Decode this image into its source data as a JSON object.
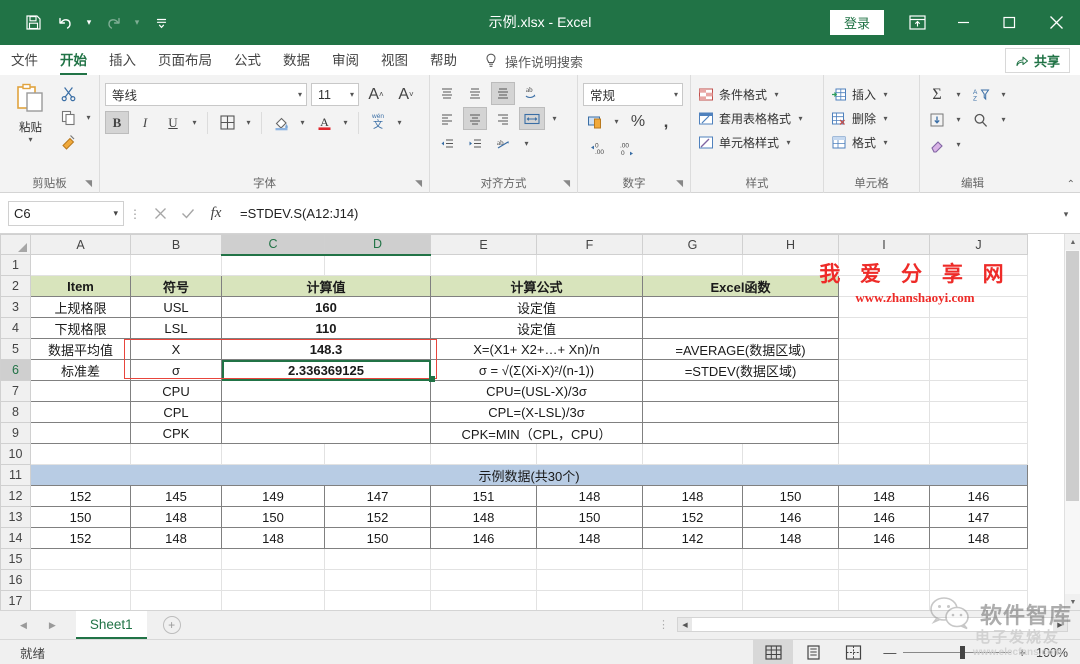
{
  "titlebar": {
    "document_title": "示例.xlsx  -  Excel",
    "quick_access": [
      {
        "name": "save",
        "glyph": "save-icon"
      },
      {
        "name": "undo",
        "glyph": "undo-icon"
      },
      {
        "name": "redo",
        "glyph": "redo-icon"
      },
      {
        "name": "customize",
        "glyph": "more-icon"
      }
    ],
    "signin_label": "登录",
    "ribbon_display_label": "ribbon-display-options",
    "minimize_label": "—",
    "maximize_label": "▢",
    "close_label": "✕"
  },
  "ribbon_tabs": [
    {
      "label": "文件",
      "active": false
    },
    {
      "label": "开始",
      "active": true
    },
    {
      "label": "插入",
      "active": false
    },
    {
      "label": "页面布局",
      "active": false
    },
    {
      "label": "公式",
      "active": false
    },
    {
      "label": "数据",
      "active": false
    },
    {
      "label": "审阅",
      "active": false
    },
    {
      "label": "视图",
      "active": false
    },
    {
      "label": "帮助",
      "active": false
    }
  ],
  "tell_me": "操作说明搜索",
  "share_label": "共享",
  "ribbon": {
    "clipboard": {
      "label": "剪贴板",
      "paste_label": "粘贴",
      "cut_label": "剪切",
      "copy_label": "复制",
      "format_painter_label": "格式刷"
    },
    "font": {
      "label": "字体",
      "font_name": "等线",
      "font_size": "11",
      "grow_label": "A",
      "shrink_label": "A",
      "bold_label": "B",
      "italic_label": "I",
      "underline_label": "U",
      "border_label": "borders-icon",
      "fill_label": "fill-color-icon",
      "fontcolor_label": "font-color-icon",
      "phonetic_label": "拼音"
    },
    "alignment": {
      "label": "对齐方式",
      "wrap_label": "自动换行",
      "merge_label": "合并后居中"
    },
    "number": {
      "label": "数字",
      "format_value": "常规",
      "percent_label": "%",
      "comma_label": "，"
    },
    "styles": {
      "label": "样式",
      "items": [
        "条件格式",
        "套用表格格式",
        "单元格样式"
      ]
    },
    "cells": {
      "label": "单元格",
      "items": [
        "插入",
        "删除",
        "格式"
      ]
    },
    "editing": {
      "label": "编辑",
      "sum_label": "Σ",
      "sort_label": "排序和筛选",
      "fill_label": "填充",
      "find_label": "查找和选择",
      "clear_label": "清除"
    }
  },
  "formula_bar": {
    "name_box": "C6",
    "cancel_label": "✕",
    "enter_label": "✓",
    "fx_label": "fx",
    "formula": "=STDEV.S(A12:J14)"
  },
  "grid": {
    "columns": [
      "A",
      "B",
      "C",
      "D",
      "E",
      "F",
      "G",
      "H",
      "I",
      "J"
    ],
    "selected_columns": [
      "C",
      "D"
    ],
    "rows": [
      "1",
      "2",
      "3",
      "4",
      "5",
      "6",
      "7",
      "8",
      "9",
      "10",
      "11",
      "12",
      "13",
      "14",
      "15",
      "16",
      "17"
    ],
    "selected_row": "6",
    "selected_cell": "C6",
    "table": {
      "headers": [
        "Item",
        "符号",
        "计算值",
        "计算公式",
        "Excel函数"
      ],
      "rows": [
        {
          "item": "上规格限",
          "symbol": "USL",
          "value": "160",
          "formula": "设定值",
          "excel_fn": ""
        },
        {
          "item": "下规格限",
          "symbol": "LSL",
          "value": "110",
          "formula": "设定值",
          "excel_fn": ""
        },
        {
          "item": "数据平均值",
          "symbol": "X",
          "value": "148.3",
          "formula": "X=(X1+ X2+…+ Xn)/n",
          "excel_fn": "=AVERAGE(数据区域)"
        },
        {
          "item": "标准差",
          "symbol": "σ",
          "value": "2.336369125",
          "formula": "σ = √(Σ(Xi-X)²/(n-1))",
          "excel_fn": "=STDEV(数据区域)"
        },
        {
          "item": "",
          "symbol": "CPU",
          "value": "",
          "formula": "CPU=(USL-X)/3σ",
          "excel_fn": ""
        },
        {
          "item": "",
          "symbol": "CPL",
          "value": "",
          "formula": "CPL=(X-LSL)/3σ",
          "excel_fn": ""
        },
        {
          "item": "",
          "symbol": "CPK",
          "value": "",
          "formula": "CPK=MIN（CPL，CPU）",
          "excel_fn": ""
        }
      ]
    },
    "sample_banner": "示例数据(共30个)",
    "sample_data": [
      [
        "152",
        "145",
        "149",
        "147",
        "151",
        "148",
        "148",
        "150",
        "148",
        "146"
      ],
      [
        "150",
        "148",
        "150",
        "152",
        "148",
        "150",
        "152",
        "146",
        "146",
        "147"
      ],
      [
        "152",
        "148",
        "148",
        "150",
        "146",
        "148",
        "142",
        "148",
        "146",
        "148"
      ]
    ]
  },
  "watermark_top": {
    "line1": "我 爱 分 享 网",
    "line2": "www.zhanshaoyi.com"
  },
  "watermark_bottom": {
    "brand": "软件智库",
    "faint_line1": "电子发烧友",
    "faint_line2": "www.elecfans.com"
  },
  "sheet_tabs": {
    "prev_label": "◀",
    "next_label": "▶",
    "tabs": [
      "Sheet1"
    ],
    "add_label": "+"
  },
  "status_bar": {
    "status": "就绪",
    "view_normal": "normal-view-icon",
    "view_layout": "page-layout-icon",
    "view_pagebreak": "page-break-icon",
    "zoom_out": "—",
    "zoom_in": "+",
    "zoom_level": "100%"
  },
  "colors": {
    "excel_green": "#217346",
    "header_fill": "#d8e4bc",
    "banner_fill": "#b8cce4",
    "annotation_red": "#e8453c",
    "watermark_red": "#ee2b28"
  }
}
